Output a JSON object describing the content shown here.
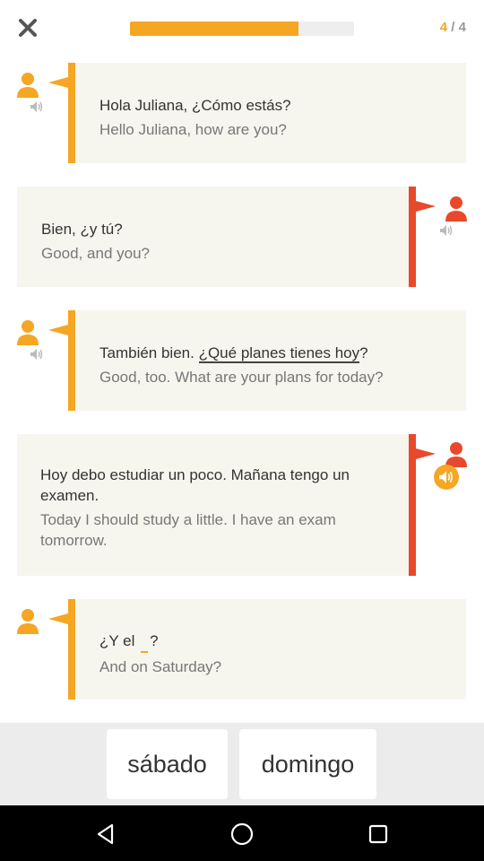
{
  "header": {
    "progress_fraction": 0.75,
    "counter_current": "4",
    "counter_sep": " / ",
    "counter_total": "4"
  },
  "dialog": [
    {
      "speaker": "left",
      "es": "Hola Juliana, ¿Cómo estás?",
      "en": "Hello Juliana, how are you?"
    },
    {
      "speaker": "right",
      "es": "Bien, ¿y tú?",
      "en": "Good, and you?"
    },
    {
      "speaker": "left",
      "es_before": "También bien. ",
      "es_underlined": "¿Qué planes tienes hoy",
      "es_after": "?",
      "en": "Good, too. What are your plans for today?"
    },
    {
      "speaker": "right",
      "es": "Hoy debo estudiar un poco. Mañana tengo un examen.",
      "en": "Today I should study a little. I have an exam tomorrow.",
      "audio_playing": true
    },
    {
      "speaker": "left",
      "es_before": "¿Y el ",
      "es_after": "?",
      "en": "And on Saturday?"
    }
  ],
  "choices": [
    "sábado",
    "domingo"
  ],
  "colors": {
    "accent": "#f5a623",
    "speaker_right": "#e8492c",
    "bubble_bg": "#f6f6ef"
  },
  "icons": {
    "close": "close-icon",
    "avatar": "person-icon",
    "audio": "speaker-icon",
    "nav_back": "back-triangle-icon",
    "nav_home": "home-circle-icon",
    "nav_recents": "recents-square-icon"
  }
}
